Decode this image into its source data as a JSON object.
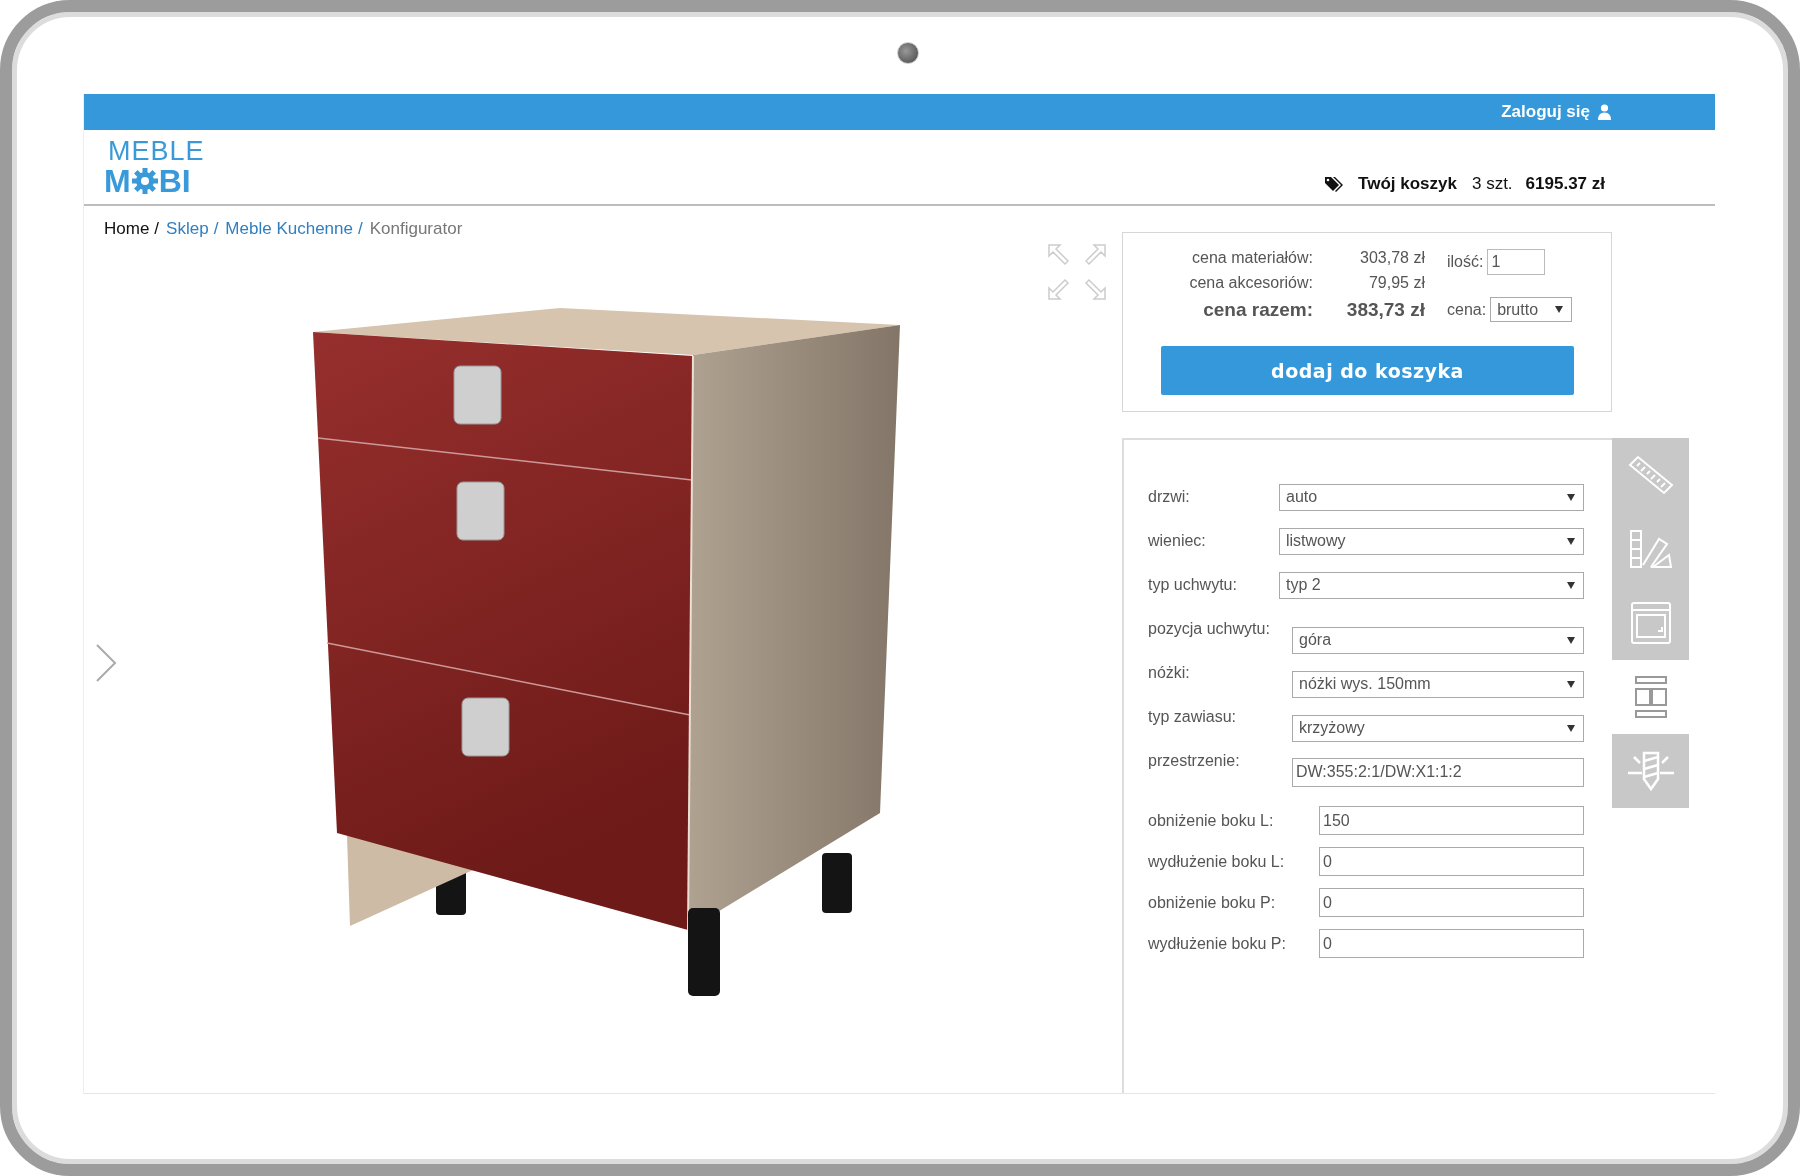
{
  "top_bar": {
    "login_link": "Zaloguj się"
  },
  "logo": {
    "top": "MEBLE",
    "bottom_left": "M",
    "bottom_right": "BI"
  },
  "cart": {
    "label": "Twój koszyk",
    "count": "3 szt.",
    "total": "6195.37 zł"
  },
  "breadcrumb": {
    "separator": "/",
    "items": [
      {
        "label": "Home",
        "kind": "plain"
      },
      {
        "label": "Sklep",
        "kind": "link"
      },
      {
        "label": "Meble Kuchenne",
        "kind": "link"
      },
      {
        "label": "Konfigurator",
        "kind": "current"
      }
    ]
  },
  "price": {
    "rows": [
      {
        "label": "cena materiałów:",
        "value": "303,78 zł",
        "kind": "part"
      },
      {
        "label": "cena akcesoriów:",
        "value": "79,95 zł",
        "kind": "part"
      },
      {
        "label": "cena razem:",
        "value": "383,73 zł",
        "kind": "total"
      }
    ],
    "quantity": {
      "label": "ilość:",
      "value": "1"
    },
    "price_type": {
      "label": "cena:",
      "value": "brutto"
    },
    "add_button": "dodaj do koszyka"
  },
  "options_top": [
    {
      "label": "drzwi:",
      "value": "auto",
      "kind": "select"
    },
    {
      "label": "wieniec:",
      "value": "listwowy",
      "kind": "select"
    },
    {
      "label": "typ uchwytu:",
      "value": "typ 2",
      "kind": "select"
    }
  ],
  "options_middle": {
    "labels": [
      "pozycja uchwytu:",
      "nóżki:",
      "typ zawiasu:",
      "przestrzenie:"
    ],
    "fields": [
      {
        "value": "góra",
        "kind": "select"
      },
      {
        "value": "nóżki wys. 150mm",
        "kind": "select"
      },
      {
        "value": "krzyżowy",
        "kind": "select"
      },
      {
        "value": "DW:355:2:1/DW:X1:1:2",
        "kind": "text"
      }
    ]
  },
  "options_bottom": [
    {
      "label": "obniżenie boku L:",
      "value": "150",
      "kind": "text"
    },
    {
      "label": "wydłużenie boku L:",
      "value": "0",
      "kind": "text"
    },
    {
      "label": "obniżenie boku P:",
      "value": "0",
      "kind": "text"
    },
    {
      "label": "wydłużenie boku P:",
      "value": "0",
      "kind": "text"
    }
  ],
  "side_tabs": [
    {
      "kind": "ruler",
      "selected": false
    },
    {
      "kind": "swatches",
      "selected": false
    },
    {
      "kind": "oven",
      "selected": false
    },
    {
      "kind": "layout",
      "selected": true
    },
    {
      "kind": "drill",
      "selected": false
    }
  ]
}
